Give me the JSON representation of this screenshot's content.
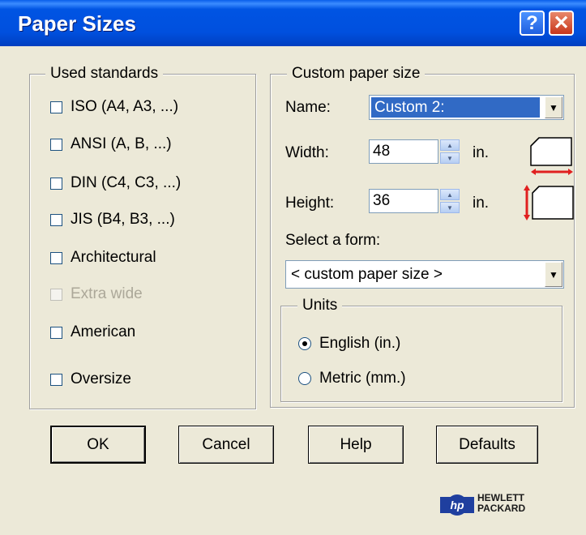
{
  "window": {
    "title": "Paper Sizes"
  },
  "used_standards": {
    "legend": "Used standards",
    "items": [
      {
        "label": "ISO (A4, A3, ...)",
        "checked": false,
        "enabled": true
      },
      {
        "label": "ANSI (A, B, ...)",
        "checked": false,
        "enabled": true
      },
      {
        "label": "DIN (C4, C3, ...)",
        "checked": false,
        "enabled": true
      },
      {
        "label": "JIS (B4, B3, ...)",
        "checked": false,
        "enabled": true
      },
      {
        "label": "Architectural",
        "checked": false,
        "enabled": true
      },
      {
        "label": "Extra wide",
        "checked": false,
        "enabled": false
      },
      {
        "label": "American",
        "checked": false,
        "enabled": true
      },
      {
        "label": "Oversize",
        "checked": false,
        "enabled": true
      }
    ]
  },
  "custom": {
    "legend": "Custom paper size",
    "name_label": "Name:",
    "name_value": "Custom 2:",
    "width_label": "Width:",
    "width_value": "48",
    "width_unit": "in.",
    "height_label": "Height:",
    "height_value": "36",
    "height_unit": "in.",
    "form_label": "Select a form:",
    "form_value": "< custom paper size >",
    "units": {
      "legend": "Units",
      "options": [
        {
          "label": "English (in.)",
          "selected": true
        },
        {
          "label": "Metric (mm.)",
          "selected": false
        }
      ]
    }
  },
  "buttons": {
    "ok": "OK",
    "cancel": "Cancel",
    "help": "Help",
    "defaults": "Defaults"
  },
  "brand": {
    "logo": "hp",
    "line1": "HEWLETT",
    "line2": "PACKARD"
  },
  "colors": {
    "titlebar": "#0054E3",
    "selection": "#316AC5",
    "accent_red": "#E02020",
    "brand_blue": "#1F3F9F"
  },
  "icons": {
    "help": "question-mark-icon",
    "close": "close-x-icon",
    "width": "paper-width-icon",
    "height": "paper-height-icon"
  }
}
